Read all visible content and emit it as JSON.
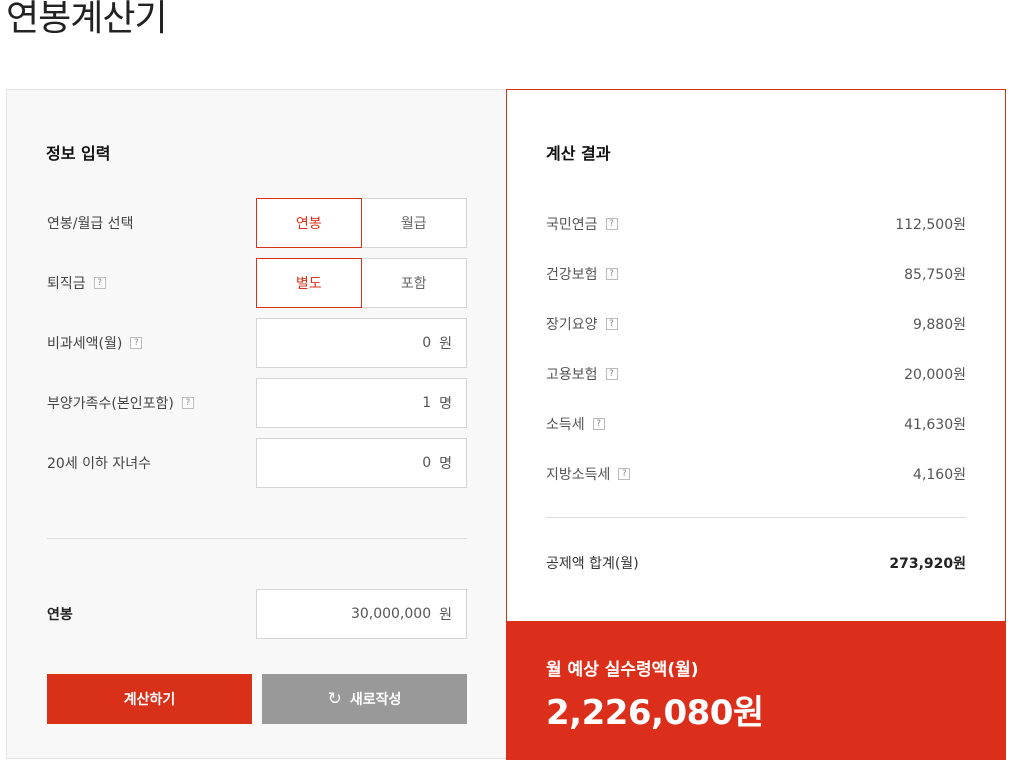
{
  "page": {
    "title": "연봉계산기"
  },
  "input_section": {
    "title": "정보 입력",
    "salary_type": {
      "label": "연봉/월급 선택",
      "options": [
        "연봉",
        "월급"
      ],
      "selected": "연봉"
    },
    "severance": {
      "label": "퇴직금",
      "help_icon": "?",
      "options": [
        "별도",
        "포함"
      ],
      "selected": "별도"
    },
    "nontaxable": {
      "label": "비과세액(월)",
      "help_icon": "?",
      "value": "0",
      "unit": "원"
    },
    "dependents": {
      "label": "부양가족수(본인포함)",
      "help_icon": "?",
      "value": "1",
      "unit": "명"
    },
    "children": {
      "label": "20세 이하 자녀수",
      "value": "0",
      "unit": "명"
    },
    "annual_salary": {
      "label": "연봉",
      "value": "30,000,000",
      "unit": "원"
    },
    "buttons": {
      "calculate": "계산하기",
      "reset": "새로작성",
      "reset_icon": "refresh-icon"
    }
  },
  "result_section": {
    "title": "계산 결과",
    "help_icon": "?",
    "items": [
      {
        "label": "국민연금",
        "amount": "112,500원"
      },
      {
        "label": "건강보험",
        "amount": "85,750원"
      },
      {
        "label": "장기요양",
        "amount": "9,880원"
      },
      {
        "label": "고용보험",
        "amount": "20,000원"
      },
      {
        "label": "소득세",
        "amount": "41,630원"
      },
      {
        "label": "지방소득세",
        "amount": "4,160원"
      }
    ],
    "total": {
      "label": "공제액 합계(월)",
      "amount": "273,920원"
    },
    "net": {
      "label": "월 예상 실수령액(월)",
      "amount": "2,226,080원"
    }
  },
  "colors": {
    "accent": "#dc2f1b",
    "reset_button": "#999999"
  }
}
